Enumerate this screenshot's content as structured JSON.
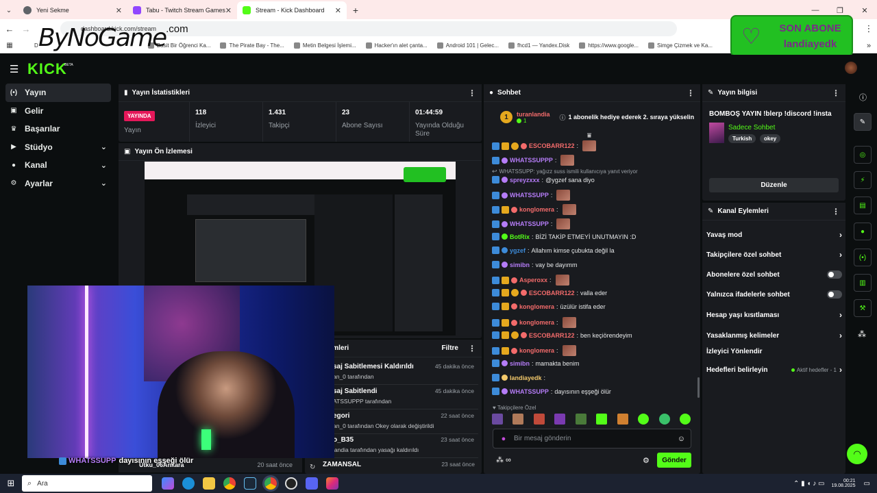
{
  "browser": {
    "tabs": [
      {
        "label": "Yeni Sekme",
        "color": "#5f6368"
      },
      {
        "label": "Tabu - Twitch Stream Games",
        "color": "#9146ff"
      },
      {
        "label": "Stream - Kick Dashboard",
        "color": "#53fc18"
      }
    ],
    "new_tab": "+",
    "address": "dashboard.kick.com/stream",
    "bookmarks": [
      "D",
      "Basit Bir Öğrenci Ka...",
      "The Pirate Bay - The...",
      "Metin Belgesi İşlemi...",
      "Hacker'ın alet çanta...",
      "Android 101 | Gelec...",
      "fhcd1 — Yandex.Disk",
      "https://www.google...",
      "Simge Çizmek ve Ka..."
    ]
  },
  "overlay": {
    "watermark": "ByNoGame",
    "watermark_suffix": ".com",
    "son_abone_title": "SON ABONE",
    "son_abone_name": "landiayedk",
    "caption_user": "WHATSSUPP",
    "caption_text": "dayısının eşşeği ölür"
  },
  "kick": {
    "logo": "KICK",
    "logo_beta": "BETA",
    "nav": [
      {
        "label": "Yayın",
        "icon": "broadcast-icon",
        "chev": false,
        "active": true
      },
      {
        "label": "Gelir",
        "icon": "wallet-icon",
        "chev": false
      },
      {
        "label": "Başarılar",
        "icon": "trophy-icon",
        "chev": false
      },
      {
        "label": "Stüdyo",
        "icon": "camera-icon",
        "chev": true
      },
      {
        "label": "Kanal",
        "icon": "person-icon",
        "chev": true
      },
      {
        "label": "Ayarlar",
        "icon": "gear-icon",
        "chev": true
      }
    ],
    "stats_panel": {
      "title": "Yayın İstatistikleri",
      "live_badge": "YAYINDA",
      "live_label": "Yayın",
      "items": [
        {
          "value": "118",
          "label": "İzleyici"
        },
        {
          "value": "1.431",
          "label": "Takipçi"
        },
        {
          "value": "23",
          "label": "Abone Sayısı"
        },
        {
          "value": "01:44:59",
          "label": "Yayında Olduğu Süre"
        }
      ]
    },
    "preview_panel": {
      "title": "Yayın Ön İzlemesi"
    },
    "mod_panel": {
      "title": "m Eylemleri",
      "filter": "Filtre",
      "rows": [
        {
          "title": "saj Sabitlemesi Kaldırıldı",
          "sub": "an_0 tarafından",
          "time": "45 dakika önce"
        },
        {
          "title": "saj Sabitlendi",
          "sub": "ATSSUPPP tarafından",
          "time": "45 dakika önce"
        },
        {
          "title": "egori",
          "sub": "an_0 tarafından Okey olarak değiştirildi",
          "time": "22 saat önce"
        },
        {
          "title": "o_B35",
          "sub": "landia tarafından yasağı kaldırıldı",
          "time": "23 saat önce"
        },
        {
          "title": "ZAMANSAL",
          "sub": "",
          "time": "23 saat önce"
        }
      ],
      "bottom_left_user": "Utku_06Ankara",
      "bottom_left_time": "20 saat önce"
    },
    "chat": {
      "title": "Sohbet",
      "gift_user": "turanlandia",
      "gift_count": "1",
      "gift_text": "1 abonelik hediye ederek 2. sıraya yükselin",
      "messages": [
        {
          "user": "ESCOBARR122",
          "color": "#f36b6b",
          "text": "",
          "emote": true
        },
        {
          "user": "WHATSSUPPP",
          "color": "#b57cf7",
          "text": "",
          "emote": true
        },
        {
          "user": "",
          "color": "#9aa0a6",
          "text": "WHATSSUPP: yağızz suss ismili kullanıcıya yanıt veriyor",
          "emote": false,
          "reply": true
        },
        {
          "user": "spreyzxxx",
          "color": "#b57cf7",
          "text": "@ygzef sana diyo",
          "emote": false
        },
        {
          "user": "WHATSSUPP",
          "color": "#b57cf7",
          "text": "",
          "emote": true
        },
        {
          "user": "konglomera",
          "color": "#f36b6b",
          "text": "",
          "emote": true
        },
        {
          "user": "WHATSSUPP",
          "color": "#b57cf7",
          "text": "",
          "emote": true
        },
        {
          "user": "BotRix",
          "color": "#53fc18",
          "text": "BİZİ TAKİP ETMEYİ UNUTMAYIN :D",
          "emote": false
        },
        {
          "user": "ygzef",
          "color": "#3d8bd9",
          "text": "Allahım kimse çubukta değil la",
          "emote": false
        },
        {
          "user": "simibn",
          "color": "#b57cf7",
          "text": "vay be dayımm",
          "emote": false
        },
        {
          "user": "Asperoxx",
          "color": "#f36b6b",
          "text": "",
          "emote": true
        },
        {
          "user": "ESCOBARR122",
          "color": "#f36b6b",
          "text": "valla eder",
          "emote": false
        },
        {
          "user": "konglomera",
          "color": "#f36b6b",
          "text": "üzülür istifa eder",
          "emote": false
        },
        {
          "user": "konglomera",
          "color": "#f36b6b",
          "text": "",
          "emote": true
        },
        {
          "user": "ESCOBARR122",
          "color": "#f36b6b",
          "text": "ben keçiörendeyim",
          "emote": false
        },
        {
          "user": "konglomera",
          "color": "#f36b6b",
          "text": "",
          "emote": true
        },
        {
          "user": "simibn",
          "color": "#b57cf7",
          "text": "mamakta benim",
          "emote": false
        },
        {
          "user": "landiayedk",
          "color": "#f3c96b",
          "text": "",
          "emote": false
        },
        {
          "user": "WHATSSUPP",
          "color": "#b57cf7",
          "text": "dayısının eşşeği ölür",
          "emote": false
        }
      ],
      "followers_only": "Takipçilere Özel",
      "input_placeholder": "Bir mesaj gönderin",
      "send_label": "Gönder"
    },
    "info_panel": {
      "title": "Yayın bilgisi",
      "stream_title": "BOMBOŞ YAYIN !blerp !discord !insta",
      "category": "Sadece Sohbet",
      "tags": [
        "Turkish",
        "okey"
      ],
      "edit_label": "Düzenle"
    },
    "channel_actions": {
      "title": "Kanal Eylemleri",
      "rows": [
        {
          "label": "Yavaş mod",
          "kind": "chev"
        },
        {
          "label": "Takipçilere özel sohbet",
          "kind": "chev"
        },
        {
          "label": "Abonelere özel sohbet",
          "kind": "toggle"
        },
        {
          "label": "Yalnızca ifadelerle sohbet",
          "kind": "toggle"
        },
        {
          "label": "Hesap yaşı kısıtlaması",
          "kind": "chev"
        },
        {
          "label": "Yasaklanmış kelimeler",
          "kind": "chev"
        },
        {
          "label": "İzleyici Yönlendir",
          "kind": "none"
        },
        {
          "label": "Hedefleri belirleyin",
          "kind": "goal"
        }
      ],
      "goal_status": "Aktif hedefler - 1"
    }
  },
  "taskbar": {
    "search": "Ara",
    "time": "00:21",
    "date": "19.08.2025"
  }
}
